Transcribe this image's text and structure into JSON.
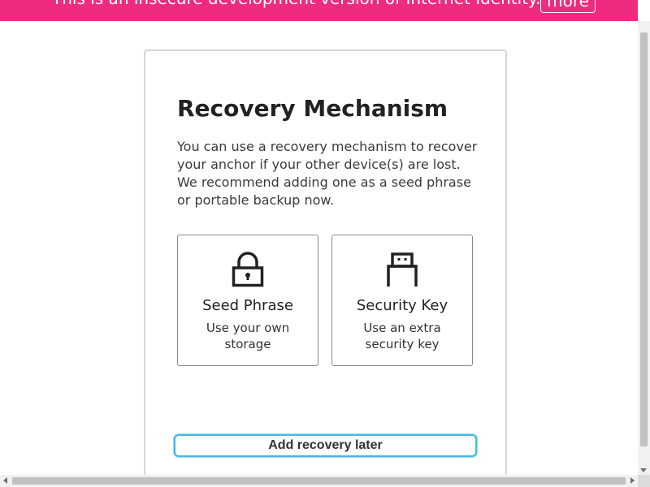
{
  "banner": {
    "text": "This is an insecure development version of Internet Identity.",
    "more_label": "more",
    "color": "#ee2b7e"
  },
  "main": {
    "title": "Recovery Mechanism",
    "description": "You can use a recovery mechanism to recover your anchor if your other device(s) are lost. We recommend adding one as a seed phrase or portable backup now.",
    "options": [
      {
        "icon": "lock-icon",
        "title": "Seed Phrase",
        "description": "Use your own storage"
      },
      {
        "icon": "usb-key-icon",
        "title": "Security Key",
        "description": "Use an extra security key"
      }
    ],
    "later_button": "Add recovery later",
    "focus_color": "#47b6e6"
  }
}
